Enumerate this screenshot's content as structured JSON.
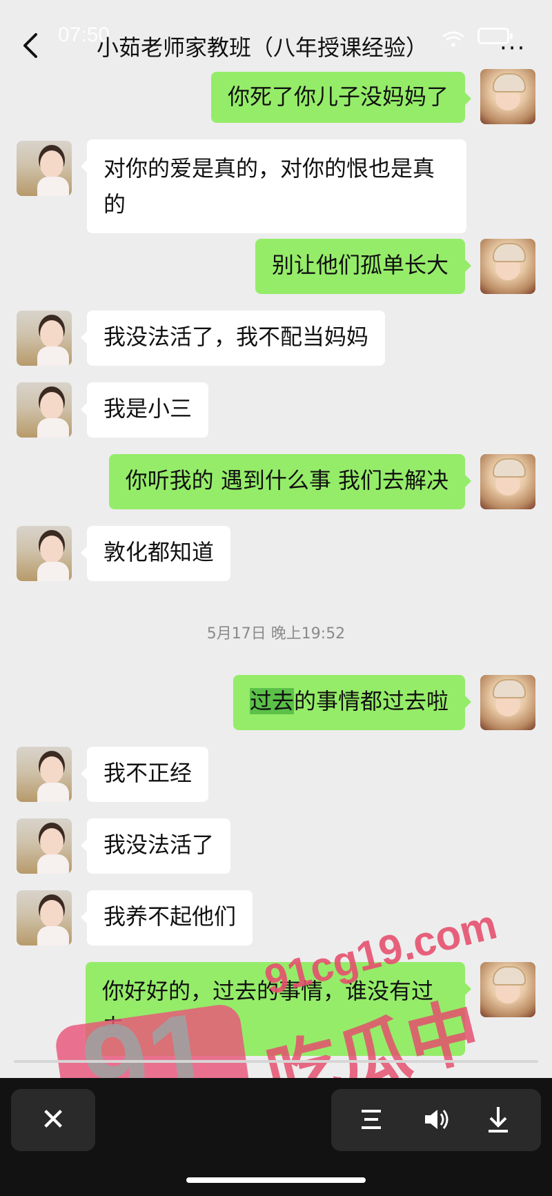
{
  "header": {
    "time": "07:50",
    "title": "小茹老师家教班（八年授课经验）"
  },
  "messages": [
    {
      "side": "out",
      "text": "你死了你儿子没妈妈了"
    },
    {
      "side": "in",
      "text": "对你的爱是真的，对你的恨也是真的"
    },
    {
      "side": "out",
      "text": "别让他们孤单长大"
    },
    {
      "side": "in",
      "text": "我没法活了，我不配当妈妈"
    },
    {
      "side": "in",
      "text": "我是小三"
    },
    {
      "side": "out",
      "text": "你听我的 遇到什么事 我们去解决"
    },
    {
      "side": "in",
      "text": "敦化都知道"
    },
    {
      "side": "out",
      "text_highlight": "过去",
      "text_rest": "的事情都过去啦"
    },
    {
      "side": "in",
      "text": "我不正经"
    },
    {
      "side": "in",
      "text": "我没法活了"
    },
    {
      "side": "in",
      "text": "我养不起他们"
    },
    {
      "side": "out",
      "text": "你好好的，过去的事情，谁没有过去"
    }
  ],
  "timestamp": "5月17日 晚上19:52",
  "watermark": {
    "logo_number": "91",
    "domain": "91cg19.com",
    "chinese": "吃瓜中心"
  },
  "bottom_bar": {
    "close_glyph": "✕",
    "icons": [
      "close-icon",
      "menu-icon",
      "volume-icon",
      "download-icon"
    ]
  },
  "colors": {
    "background": "#ededed",
    "bubble_out": "#95ec69",
    "bubble_in": "#ffffff",
    "highlight": "#5bc149",
    "watermark": "#e8557a"
  }
}
